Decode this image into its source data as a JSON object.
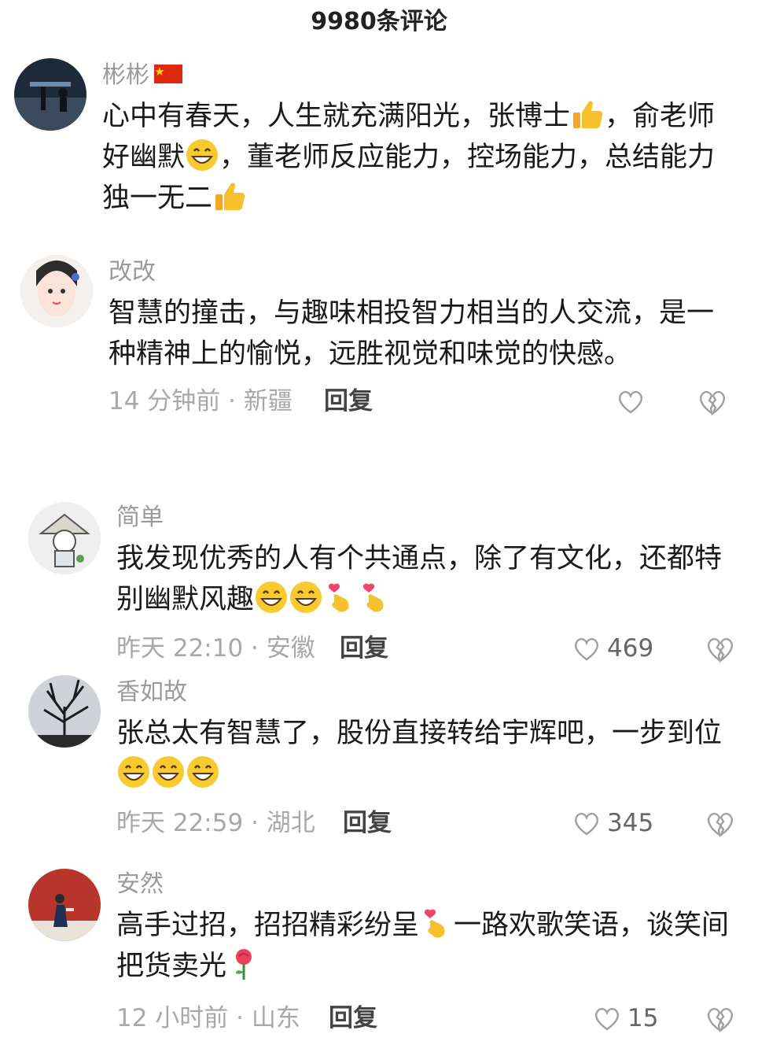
{
  "header": {
    "title": "9980条评论"
  },
  "comments": [
    {
      "user": "彬彬",
      "segments": [
        "心中有春天，人生就充满阳光，张博士",
        "，俞老师好幽默",
        "，董老师反应能力，控场能力，总结能力独一无二"
      ],
      "emojis": [
        "thumbs-up-emoji",
        "grin-emoji",
        "thumbs-up-emoji"
      ],
      "time_location": "",
      "reply": "",
      "likes": ""
    },
    {
      "user": "改改",
      "text": "智慧的撞击，与趣味相投智力相当的人交流，是一种精神上的愉悦，远胜视觉和味觉的快感。",
      "time_location": "14 分钟前 · 新疆",
      "reply": "回复",
      "likes": ""
    },
    {
      "user": "简单",
      "text": "我发现优秀的人有个共通点，除了有文化，还都特别幽默风趣",
      "emojis": [
        "grin-emoji",
        "grin-emoji",
        "finger-heart-emoji",
        "finger-heart-emoji"
      ],
      "time_location": "昨天 22:10 · 安徽",
      "reply": "回复",
      "likes": "469"
    },
    {
      "user": "香如故",
      "text": "张总太有智慧了，股份直接转给宇辉吧，一步到位",
      "emojis": [
        "grin-emoji",
        "grin-emoji",
        "grin-emoji"
      ],
      "time_location": "昨天 22:59 · 湖北",
      "reply": "回复",
      "likes": "345"
    },
    {
      "user": "安然",
      "segments": [
        "高手过招，招招精彩纷呈",
        "一路欢歌笑语，谈笑间把货卖光"
      ],
      "emojis": [
        "finger-heart-emoji",
        "rose-emoji"
      ],
      "time_location": "12 小时前 · 山东",
      "reply": "回复",
      "likes": "15"
    }
  ],
  "colors": {
    "meta": "#a8a8a8",
    "username": "#9a9a9a",
    "text": "#1a1a1a",
    "flag": "#de2910"
  }
}
